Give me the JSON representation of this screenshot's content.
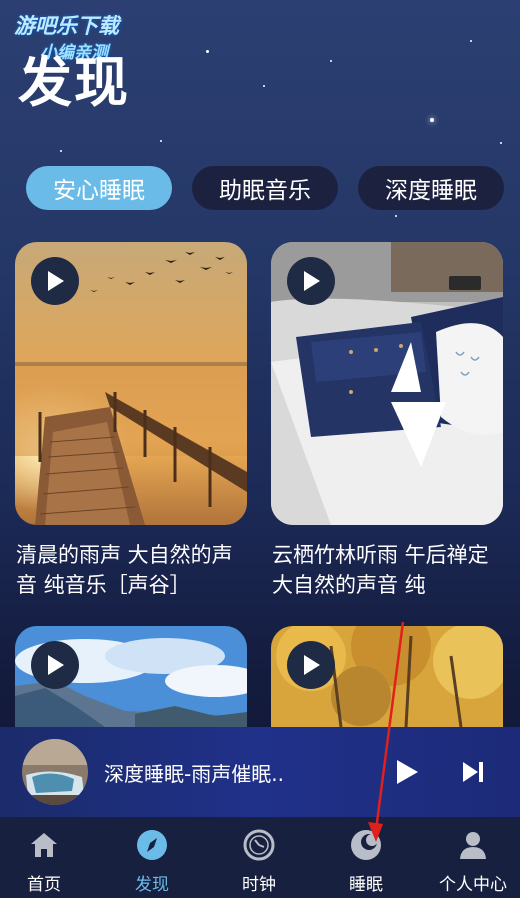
{
  "watermark": {
    "line1": "游吧乐下载",
    "line2": "小编亲测"
  },
  "page": {
    "title": "发现"
  },
  "tabs": [
    {
      "label": "安心睡眠",
      "active": true
    },
    {
      "label": "助眠音乐",
      "active": false
    },
    {
      "label": "深度睡眠",
      "active": false
    }
  ],
  "cards": [
    {
      "title": "清晨的雨声 大自然的声音 纯音乐［声谷］"
    },
    {
      "title": "云栖竹林听雨 午后禅定 大自然的声音 纯"
    },
    {
      "title": ""
    },
    {
      "title": ""
    }
  ],
  "player": {
    "title": "深度睡眠-雨声催眠.."
  },
  "bottom_nav": [
    {
      "label": "首页",
      "icon": "home-icon",
      "active": false
    },
    {
      "label": "发现",
      "icon": "compass-icon",
      "active": true
    },
    {
      "label": "时钟",
      "icon": "clock-icon",
      "active": false
    },
    {
      "label": "睡眠",
      "icon": "moon-icon",
      "active": false
    },
    {
      "label": "个人中心",
      "icon": "person-icon",
      "active": false
    }
  ],
  "colors": {
    "accent": "#6bbbe9",
    "annotation_arrow": "#e0201a"
  }
}
